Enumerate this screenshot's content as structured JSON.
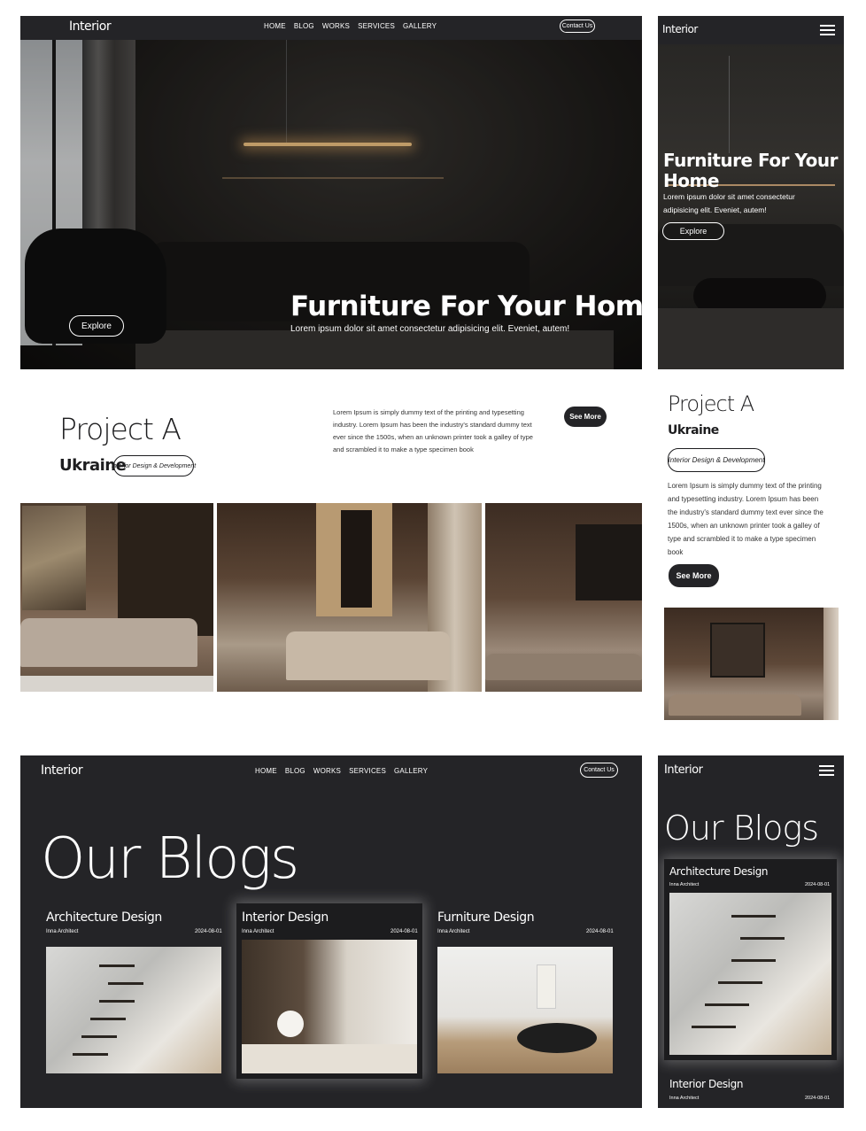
{
  "brand": "Interior",
  "nav": [
    "HOME",
    "BLOG",
    "WORKS",
    "SERVICES",
    "GALLERY"
  ],
  "contact_label": "Contact Us",
  "hero": {
    "title": "Furniture For Your Home",
    "subtitle": "Lorem ipsum dolor sit amet consectetur adipisicing elit. Eveniet, autem!",
    "subtitle_mobile_line1": "Lorem ipsum dolor sit amet consectetur",
    "subtitle_mobile_line2": "adipisicing elit. Eveniet, autem!",
    "explore_label": "Explore"
  },
  "project": {
    "title": "Project A",
    "country": "Ukraine",
    "tag": "Interior Design & Development",
    "description": "Lorem Ipsum is simply dummy text of the printing and typesetting industry. Lorem Ipsum has been the industry's standard dummy text ever since the 1500s, when an unknown printer took a galley of type and scrambled it to make a type specimen book",
    "see_more_label": "See More"
  },
  "blogs": {
    "heading": "Our Blogs",
    "cards": [
      {
        "title": "Architecture Design",
        "author": "Inna Architect",
        "date": "2024-08-01"
      },
      {
        "title": "Interior Design",
        "author": "Inna Architect",
        "date": "2024-08-01"
      },
      {
        "title": "Furniture Design",
        "author": "Inna Architect",
        "date": "2024-08-01"
      }
    ]
  },
  "icons": {
    "menu": "hamburger-menu-icon"
  },
  "colors": {
    "dark": "#242427",
    "white": "#ffffff"
  }
}
